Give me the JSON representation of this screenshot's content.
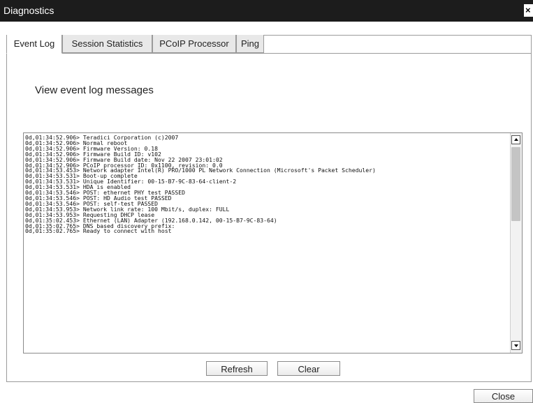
{
  "window": {
    "title": "Diagnostics",
    "close_glyph": "×"
  },
  "tabs": [
    {
      "label": "Event Log",
      "active": true
    },
    {
      "label": "Session Statistics",
      "active": false
    },
    {
      "label": "PCoIP Processor",
      "active": false
    },
    {
      "label": "Ping",
      "active": false
    }
  ],
  "main": {
    "heading": "View event log messages",
    "log_lines": [
      "0d,01:34:52.906> Teradici Corporation (c)2007",
      "0d,01:34:52.906> Normal reboot",
      "0d,01:34:52.906> Firmware Version: 0.18",
      "0d,01:34:52.906> Firmware Build ID: v102",
      "0d,01:34:52.906> Firmware Build date: Nov 22 2007 23:01:02",
      "0d,01:34:52.906> PCoIP processor ID: 0x1100, revision: 0.0",
      "0d,01:34:53.453> Network adapter Intel(R) PRO/1000 PL Network Connection (Microsoft's Packet Scheduler)",
      "0d,01:34:53.531> Boot-up complete",
      "0d,01:34:53.531> Unique Identifier: 00-15-B7-9C-83-64-client-2",
      "0d,01:34:53.531> HDA is enabled",
      "0d,01:34:53.546> POST: ethernet PHY test PASSED",
      "0d,01:34:53.546> POST: HD Audio test PASSED",
      "0d,01:34:53.546> POST: self-test PASSED",
      "0d,01:34:53.953> Network link rate: 100 Mbit/s, duplex: FULL",
      "0d,01:34:53.953> Requesting DHCP lease",
      "0d,01:35:02.453> Ethernet (LAN) Adapter (192.168.0.142, 00-15-B7-9C-83-64)",
      "0d,01:35:02.765> DNS based discovery prefix:",
      "0d,01:35:02.765> Ready to connect with host"
    ]
  },
  "buttons": {
    "refresh": "Refresh",
    "clear": "Clear",
    "close": "Close"
  }
}
